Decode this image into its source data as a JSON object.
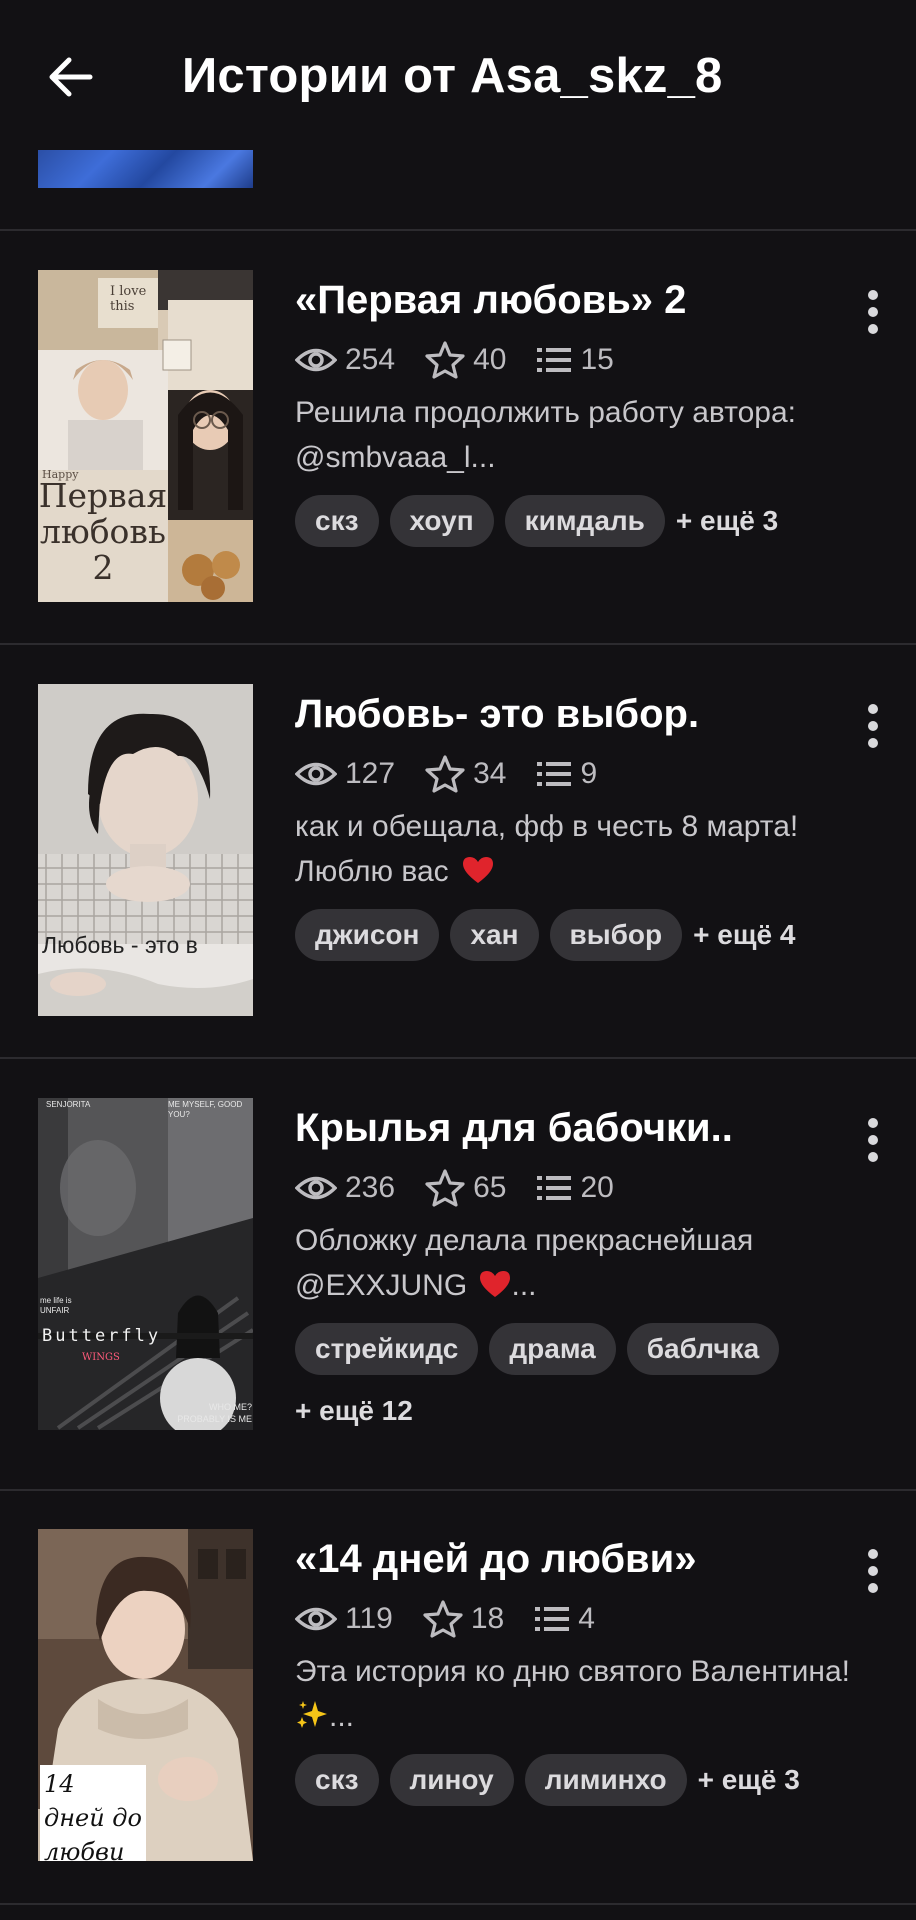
{
  "header": {
    "title": "Истории от Asa_skz_8"
  },
  "stories": [
    {
      "title": "«Первая любовь» 2",
      "views": "254",
      "votes": "40",
      "parts": "15",
      "desc_line1": "Решила продолжить работу автора:",
      "desc_line2": "@smbvaaa_l...",
      "tags": [
        "скз",
        "хоуп",
        "кимдаль"
      ],
      "more": "+ ещё 3",
      "cover_text_top": "I love this",
      "cover_text_happy": "Happy",
      "cover_text_main": "Первая любовь 2"
    },
    {
      "title": "Любовь- это выбор.",
      "views": "127",
      "votes": "34",
      "parts": "9",
      "desc_line1": "как и обещала, фф в честь 8 марта!",
      "desc_line2": "Люблю вас",
      "tags": [
        "джисон",
        "хан",
        "выбор"
      ],
      "more": "+ ещё 4",
      "cover_text_main": "Любовь - это в"
    },
    {
      "title": "Крылья для бабочки..",
      "views": "236",
      "votes": "65",
      "parts": "20",
      "desc_line1": "Обложку делала прекраснейшая",
      "desc_line2": "@EXXJUNG",
      "desc_line2_suffix": "...",
      "tags": [
        "стрейкидс",
        "драма",
        "баблчка"
      ],
      "more": "+ ещё 12",
      "cover_text_tl": "SENJORITA",
      "cover_text_tr": "ME MYSELF, GOOD YOU?",
      "cover_text_ml": "me life is UNFAIR",
      "cover_text_main": "Butterfly",
      "cover_text_wings": "WINGS",
      "cover_text_br": "WHO ME? PROBABLY IS ME"
    },
    {
      "title": "«14 дней до любви»",
      "views": "119",
      "votes": "18",
      "parts": "4",
      "desc_line1": "Эта история ко дню святого Валентина!",
      "desc_line2": "...",
      "tags": [
        "скз",
        "линоу",
        "лиминхо"
      ],
      "more": "+ ещё 3",
      "cover_text_main": "14 дней до любви"
    }
  ],
  "icons": {
    "back": "arrow-left-icon",
    "views": "eye-icon",
    "votes": "star-icon",
    "parts": "list-icon",
    "menu": "kebab-menu-icon"
  },
  "colors": {
    "background": "#121114",
    "tag_bg": "#343337",
    "secondary_text": "#bdbcc0",
    "heart": "#e0242c"
  }
}
